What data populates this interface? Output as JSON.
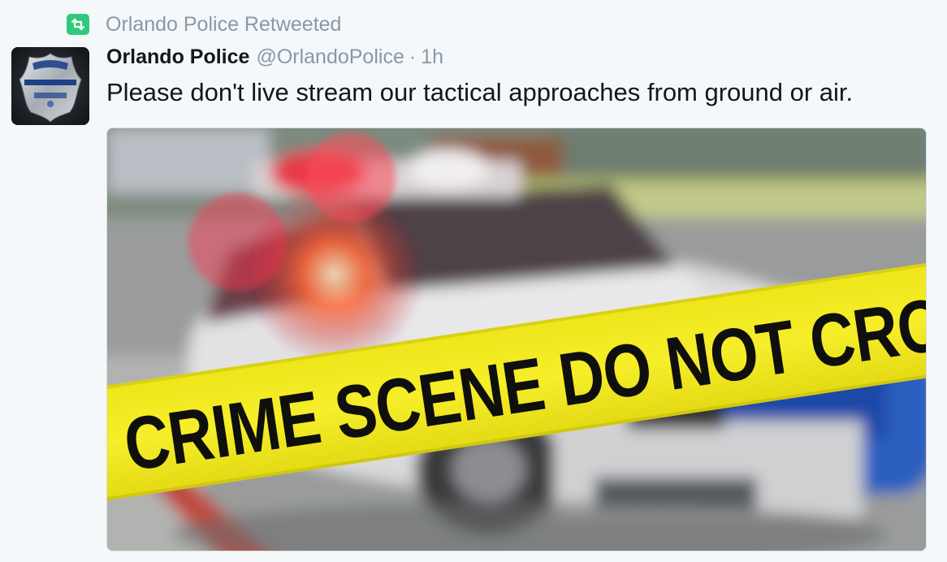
{
  "retweet": {
    "icon": "retweet-icon",
    "icon_color": "#2fca7c",
    "text": "Orlando Police Retweeted"
  },
  "tweet": {
    "avatar_icon": "police-badge-icon",
    "name": "Orlando Police",
    "handle": "@OrlandoPolice",
    "separator": "·",
    "time": "1h",
    "text": "Please don't live stream our tactical approaches from ground or air."
  },
  "media": {
    "description_icon": "police-car-photo",
    "tape_text": "CRIME SCENE DO NOT CRO",
    "tape_color": "#f1e81c"
  }
}
